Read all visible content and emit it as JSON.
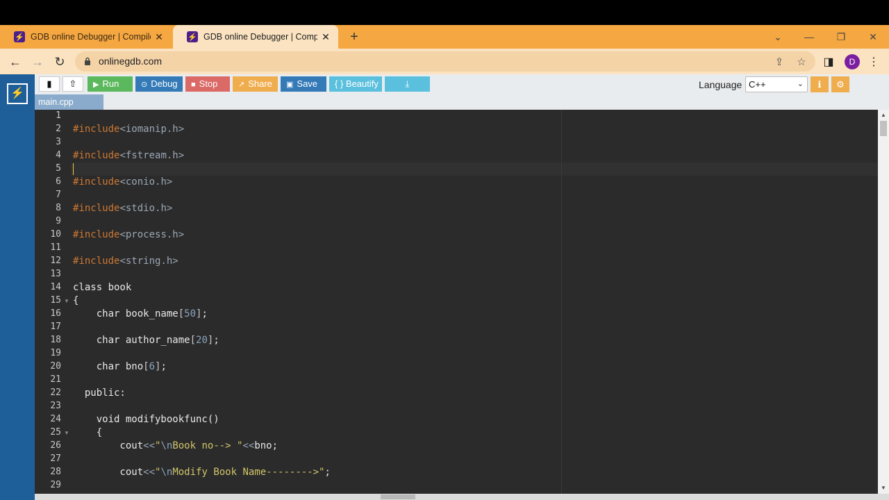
{
  "browser": {
    "tabs": [
      {
        "title": "GDB online Debugger | Compiler",
        "close": "✕"
      },
      {
        "title": "GDB online Debugger | Compiler",
        "close": "✕"
      }
    ],
    "new_tab": "+",
    "url": "onlinegdb.com",
    "profile_initial": "D"
  },
  "toolbar": {
    "run_label": "Run",
    "debug_label": "Debug",
    "stop_label": "Stop",
    "share_label": "Share",
    "save_label": "Save",
    "beautify_label": "{ } Beautify",
    "language_label": "Language",
    "language_value": "C++"
  },
  "colors": {
    "run": "#5cb85c",
    "debug": "#337ab7",
    "stop": "#d9534f",
    "share": "#f0ad4e",
    "save": "#337ab7",
    "beautify": "#5bc0de",
    "download": "#5bc0de",
    "sidebar": "#1f5f99",
    "editor_bg": "#2b2b2b"
  },
  "file_tab": "main.cpp",
  "editor": {
    "line_numbers": [
      "1",
      "2",
      "3",
      "4",
      "5",
      "6",
      "7",
      "8",
      "9",
      "10",
      "11",
      "12",
      "13",
      "14",
      "15",
      "16",
      "17",
      "18",
      "19",
      "20",
      "21",
      "22",
      "23",
      "24",
      "25",
      "26",
      "27",
      "28",
      "29"
    ],
    "lines": [
      "",
      "#include<iomanip.h>",
      "",
      "#include<fstream.h>",
      "",
      "#include<conio.h>",
      "",
      "#include<stdio.h>",
      "",
      "#include<process.h>",
      "",
      "#include<string.h>",
      "",
      "class book",
      "{",
      "    char book_name[50];",
      "",
      "    char author_name[20];",
      "",
      "    char bno[6];",
      "",
      "  public:",
      "",
      "    void modifybookfunc()",
      "    {",
      "        cout<<\"\\nBook no--> \"<<bno;",
      "",
      "        cout<<\"\\nModify Book Name-------->\";",
      ""
    ]
  }
}
